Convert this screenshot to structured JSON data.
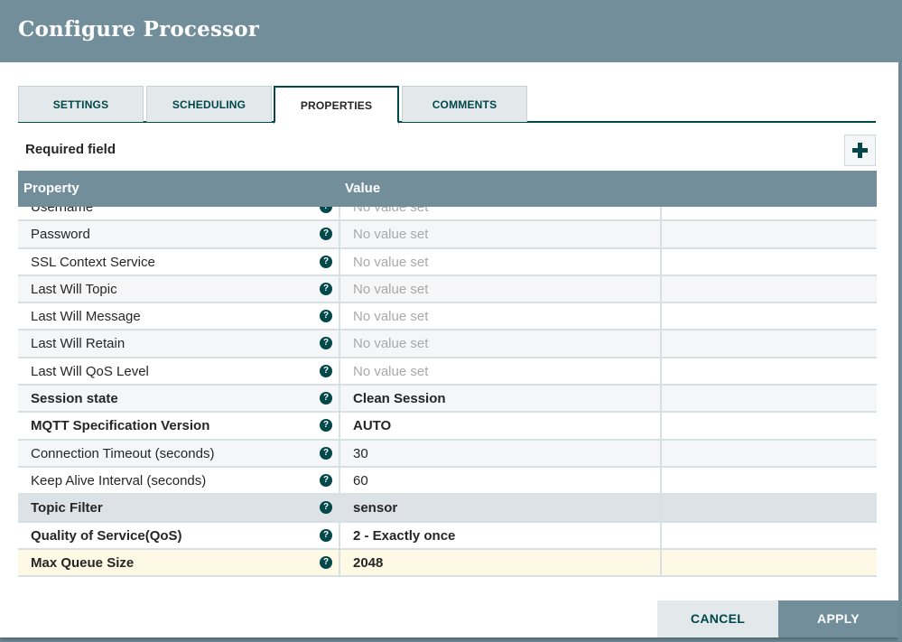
{
  "dialog": {
    "title": "Configure Processor"
  },
  "tabs": [
    {
      "label": "SETTINGS",
      "active": false
    },
    {
      "label": "SCHEDULING",
      "active": false
    },
    {
      "label": "PROPERTIES",
      "active": true
    },
    {
      "label": "COMMENTS",
      "active": false
    }
  ],
  "properties": {
    "required_label": "Required field",
    "add_button_icon": "plus-icon",
    "columns": {
      "property": "Property",
      "value": "Value"
    },
    "rows": [
      {
        "name": "Username",
        "value": "No value set",
        "empty": true,
        "required": false
      },
      {
        "name": "Password",
        "value": "No value set",
        "empty": true,
        "required": false
      },
      {
        "name": "SSL Context Service",
        "value": "No value set",
        "empty": true,
        "required": false
      },
      {
        "name": "Last Will Topic",
        "value": "No value set",
        "empty": true,
        "required": false
      },
      {
        "name": "Last Will Message",
        "value": "No value set",
        "empty": true,
        "required": false
      },
      {
        "name": "Last Will Retain",
        "value": "No value set",
        "empty": true,
        "required": false
      },
      {
        "name": "Last Will QoS Level",
        "value": "No value set",
        "empty": true,
        "required": false
      },
      {
        "name": "Session state",
        "value": "Clean Session",
        "empty": false,
        "required": true
      },
      {
        "name": "MQTT Specification Version",
        "value": "AUTO",
        "empty": false,
        "required": true
      },
      {
        "name": "Connection Timeout (seconds)",
        "value": "30",
        "empty": false,
        "required": false
      },
      {
        "name": "Keep Alive Interval (seconds)",
        "value": "60",
        "empty": false,
        "required": false
      },
      {
        "name": "Topic Filter",
        "value": "sensor",
        "empty": false,
        "required": true,
        "state": "selected"
      },
      {
        "name": "Quality of Service(QoS)",
        "value": "2 - Exactly once",
        "empty": false,
        "required": true
      },
      {
        "name": "Max Queue Size",
        "value": "2048",
        "empty": false,
        "required": true,
        "state": "highlight"
      }
    ],
    "help_icon": "question-circle-icon"
  },
  "footer": {
    "cancel_label": "CANCEL",
    "apply_label": "APPLY"
  },
  "colors": {
    "header_bg": "#728e9b",
    "accent": "#004849",
    "highlight_row": "#fef9e4",
    "selected_row": "#dce2e6"
  }
}
